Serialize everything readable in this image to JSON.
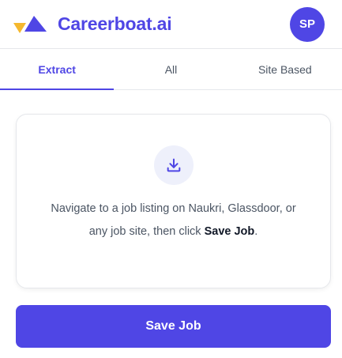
{
  "brand": {
    "name": "Careerboat.ai",
    "logo_icon": "boat-triangle-logo"
  },
  "user": {
    "initials": "SP"
  },
  "tabs": [
    {
      "label": "Extract",
      "active": true
    },
    {
      "label": "All",
      "active": false
    },
    {
      "label": "Site Based",
      "active": false
    }
  ],
  "card": {
    "icon": "download-icon",
    "message_prefix": "Navigate to a job listing on Naukri, Glassdoor, or any job site, then click ",
    "message_bold": "Save Job",
    "message_suffix": "."
  },
  "actions": {
    "save_label": "Save Job"
  },
  "colors": {
    "accent": "#4f46e5",
    "icon_bg": "#eef0fb",
    "logo_yellow": "#f5b82e"
  }
}
